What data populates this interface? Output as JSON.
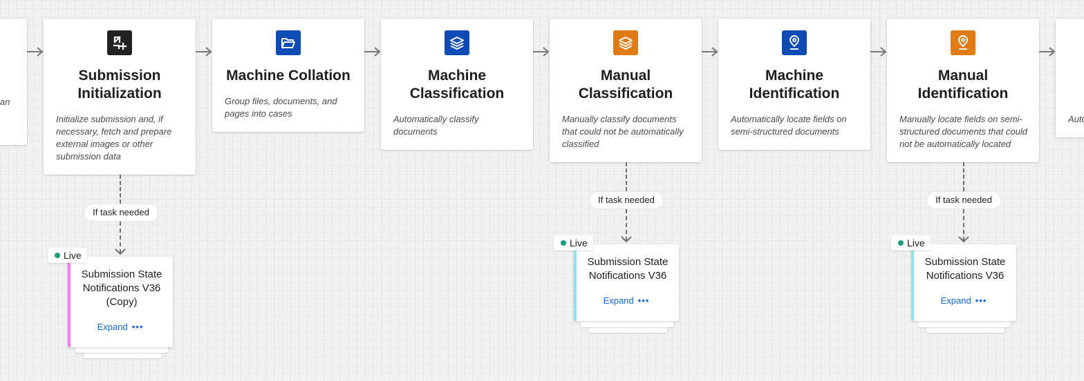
{
  "colors": {
    "canvas_bg": "#f1f1f1",
    "icon_dark": "#222222",
    "icon_blue": "#0f4bb5",
    "icon_orange": "#e07b14",
    "arrow": "#777777",
    "live_dot": "#1a9e7f",
    "accent_pink": "#f27cf0",
    "accent_cyan": "#8fe3ef",
    "link_blue": "#1769d8"
  },
  "stages": [
    {
      "id": "partial-left",
      "title": "",
      "description": "an",
      "icon": ""
    },
    {
      "id": "submission-initialization",
      "title": "Submission\nInitialization",
      "description": "Initialize submission and, if necessary, fetch and prepare external images or other submission data",
      "icon": "transform-icon",
      "icon_color": "#222222"
    },
    {
      "id": "machine-collation",
      "title": "Machine Collation",
      "description": "Group files, documents, and pages into cases",
      "icon": "folder-open-icon",
      "icon_color": "#0f4bb5"
    },
    {
      "id": "machine-classification",
      "title": "Machine\nClassification",
      "description": "Automatically classify documents",
      "icon": "layers-icon",
      "icon_color": "#0f4bb5"
    },
    {
      "id": "manual-classification",
      "title": "Manual\nClassification",
      "description": "Manually classify documents that could not be automatically classified",
      "icon": "layers-icon",
      "icon_color": "#e07b14"
    },
    {
      "id": "machine-identification",
      "title": "Machine\nIdentification",
      "description": "Automatically locate fields on semi-structured documents",
      "icon": "location-pin-icon",
      "icon_color": "#0f4bb5"
    },
    {
      "id": "manual-identification",
      "title": "Manual\nIdentification",
      "description": "Manually locate fields on semi-structured documents that could not be automatically located",
      "icon": "location-pin-icon",
      "icon_color": "#e07b14"
    },
    {
      "id": "partial-right",
      "title": "",
      "description": "Auto",
      "icon": ""
    }
  ],
  "connector_label": "If task needed",
  "tasks": [
    {
      "id": "task-1",
      "title": "Submission State\nNotifications V36\n(Copy)",
      "status": "Live",
      "expand_label": "Expand",
      "more": "•••",
      "accent": "#f27cf0"
    },
    {
      "id": "task-2",
      "title": "Submission State\nNotifications V36",
      "status": "Live",
      "expand_label": "Expand",
      "more": "•••",
      "accent": "#8fe3ef"
    },
    {
      "id": "task-3",
      "title": "Submission State\nNotifications V36",
      "status": "Live",
      "expand_label": "Expand",
      "more": "•••",
      "accent": "#8fe3ef"
    }
  ]
}
